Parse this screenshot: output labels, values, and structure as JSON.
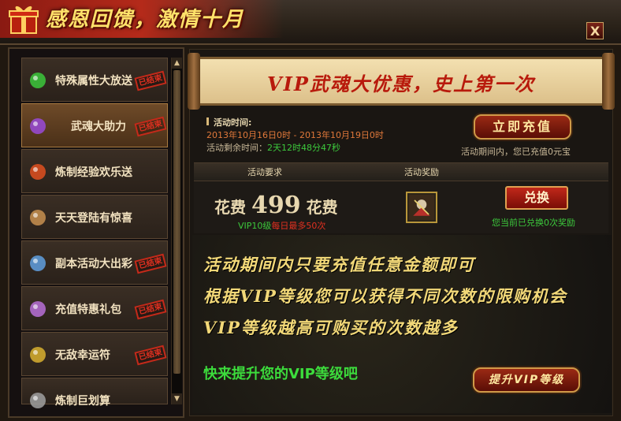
{
  "window": {
    "title": "感恩回馈，激情十月",
    "close_label": "X"
  },
  "sidebar": {
    "items": [
      {
        "label": "特殊属性大放送",
        "stamp": "已结束",
        "icon": "tree-gift-icon",
        "active": false
      },
      {
        "label": "武魂大助力",
        "stamp": "已结束",
        "icon": "purple-orb-icon",
        "active": true
      },
      {
        "label": "炼制经验欢乐送",
        "stamp": "",
        "icon": "firework-icon",
        "active": false
      },
      {
        "label": "天天登陆有惊喜",
        "stamp": "",
        "icon": "paw-icon",
        "active": false
      },
      {
        "label": "副本活动大出彩",
        "stamp": "已结束",
        "icon": "confetti-icon",
        "active": false
      },
      {
        "label": "充值特惠礼包",
        "stamp": "已结束",
        "icon": "gift-box-icon",
        "active": false
      },
      {
        "label": "无敌幸运符",
        "stamp": "已结束",
        "icon": "talisman-icon",
        "active": false
      },
      {
        "label": "炼制巨划算",
        "stamp": "",
        "icon": "furnace-icon",
        "active": false
      }
    ]
  },
  "banner": {
    "text": "VIP武魂大优惠，史上第一次"
  },
  "info": {
    "time_label": "活动时间:",
    "time_value": "2013年10月16日0时 - 2013年10月19日0时",
    "remaining_label": "活动剩余时间：",
    "remaining_value": "2天12时48分47秒"
  },
  "recharge": {
    "button_label": "立即充值",
    "note": "活动期间内，您已充值0元宝"
  },
  "table_header": {
    "requirement": "活动要求",
    "reward": "活动奖励"
  },
  "offer": {
    "prefix": "花费",
    "amount": "499",
    "suffix": "花费",
    "vip": "VIP10级",
    "limit": "每日最多50次",
    "exchange_label": "兑换",
    "exchange_note": "您当前已兑换0次奖励"
  },
  "description": {
    "lines": [
      "活动期间内只要充值任意金额即可",
      "根据VIP等级您可以获得不同次数的限购机会",
      "VIP等级越高可购买的次数越多"
    ],
    "vip_prompt": "快来提升您的VIP等级吧",
    "upgrade_label": "提升VIP等级"
  },
  "colors": {
    "accent_gold": "#ffe26a",
    "status_green": "#3cc83c",
    "stamp_red": "#e03020"
  }
}
